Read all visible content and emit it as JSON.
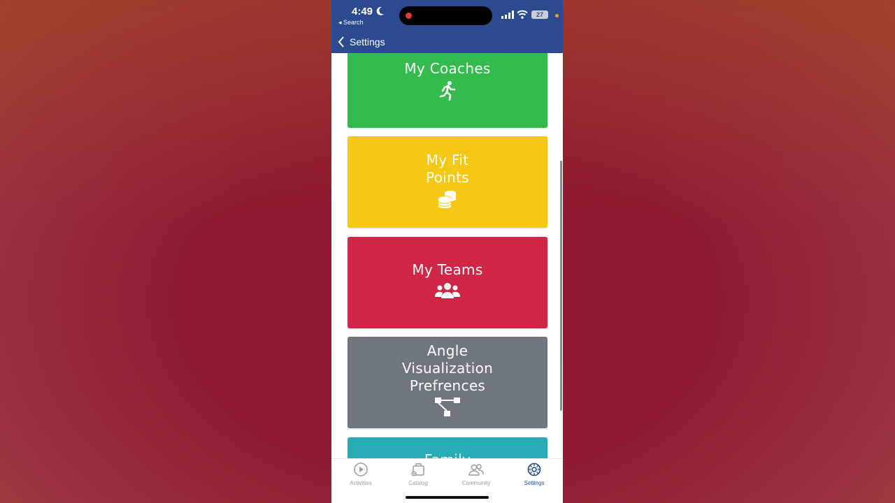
{
  "status_bar": {
    "time": "4:49",
    "back_app": "◂ Search",
    "battery": "27"
  },
  "nav": {
    "back_label": "Settings"
  },
  "cards": [
    {
      "title_lines": [
        "My Coaches"
      ],
      "color": "#34bb4d",
      "icon": "runner-icon"
    },
    {
      "title_lines": [
        "My Fit",
        "Points"
      ],
      "color": "#f5c813",
      "icon": "coins-icon"
    },
    {
      "title_lines": [
        "My Teams"
      ],
      "color": "#d02648",
      "icon": "users-icon"
    },
    {
      "title_lines": [
        "Angle",
        "Visualization",
        "Prefrences"
      ],
      "color": "#6f767e",
      "icon": "sitemap-icon"
    },
    {
      "title_lines": [
        "Family"
      ],
      "color": "#28adb6",
      "icon": ""
    }
  ],
  "tabs": [
    {
      "label": "Activities",
      "icon": "play-circle-icon",
      "active": false
    },
    {
      "label": "Catalog",
      "icon": "briefcase-icon",
      "active": false
    },
    {
      "label": "Community",
      "icon": "people-icon",
      "active": false
    },
    {
      "label": "Settings",
      "icon": "settings-icon",
      "active": true
    }
  ],
  "colors": {
    "header": "#2b4a8f",
    "active_tab": "#2b4a8f",
    "inactive_tab": "#9a9a9a"
  }
}
